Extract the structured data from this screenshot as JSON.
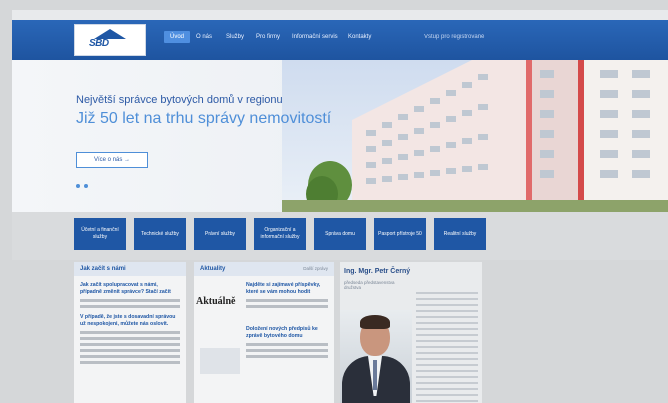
{
  "nav": {
    "items": [
      "Úvod",
      "O nás",
      "Služby",
      "Pro firmy",
      "Informační servis",
      "Kontakty"
    ],
    "active_index": 0,
    "right_text": "Vstup pro registrované"
  },
  "logo": {
    "text": "SBD"
  },
  "hero": {
    "line1": "Největší správce bytových domů v regionu",
    "line2": "Již 50 let na trhu správy nemovitostí",
    "button": "Více o nás →"
  },
  "tiles": [
    "Účetní a finanční služby",
    "Technické služby",
    "Právní služby",
    "Organizační a informační služby",
    "Správa domu",
    "Pasport přístroje 50",
    "Realitní služby"
  ],
  "col1": {
    "title": "Jak začít s námi",
    "link1": "Jak začít spolupracovat s námi, případně změnit správce? Stačí začít",
    "link2": "V případě, že jste s dosavadní správou už nespokojeni, můžete nás oslovit."
  },
  "col2": {
    "title": "Aktuality",
    "more": "Další zprávy",
    "logo_text": "Aktuálně",
    "item1": "Najděte si zajímavé příspěvky, které se vám mohou hodit",
    "item2": "Doložení nových předpisů ke zprávě bytového domu"
  },
  "person": {
    "name": "Ing. Mgr. Petr Černý",
    "role": "předseda představenstva družstva"
  }
}
